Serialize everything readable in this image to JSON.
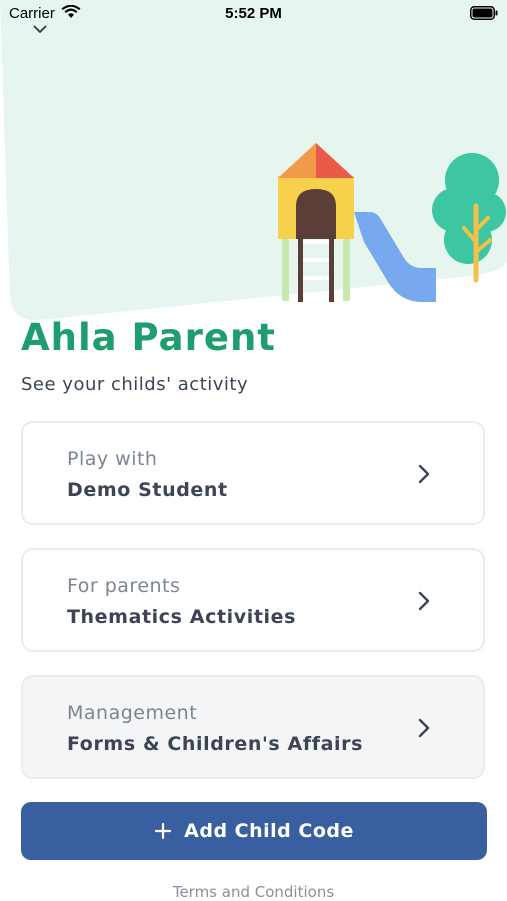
{
  "status_bar": {
    "carrier": "Carrier",
    "time": "5:52 PM"
  },
  "header": {
    "title": "Ahla Parent",
    "subtitle": "See your childs' activity"
  },
  "cards": [
    {
      "caption": "Play with",
      "title": "Demo Student"
    },
    {
      "caption": "For parents",
      "title": "Thematics Activities"
    },
    {
      "caption": "Management",
      "title": "Forms & Children's Affairs"
    }
  ],
  "add_button": {
    "label": "Add Child Code",
    "color": "#3a5fa0"
  },
  "footer": {
    "terms": "Terms and Conditions"
  },
  "colors": {
    "accent": "#1e9e6e",
    "hero_background": "#e6f5ee"
  },
  "icons": {
    "collapse": "chevron-down-icon",
    "card_arrow": "chevron-right-icon",
    "add": "plus-icon"
  }
}
